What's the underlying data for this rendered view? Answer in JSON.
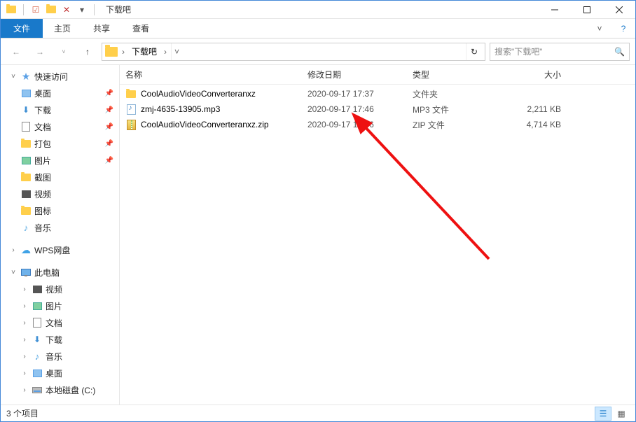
{
  "window": {
    "title": "下载吧"
  },
  "ribbon": {
    "file": "文件",
    "tabs": [
      "主页",
      "共享",
      "查看"
    ]
  },
  "address": {
    "segments": [
      "下载吧"
    ],
    "search_placeholder": "搜索\"下载吧\""
  },
  "sidebar": {
    "quick_access": "快速访问",
    "quick_items": [
      {
        "label": "桌面",
        "pin": true,
        "icon": "desktop"
      },
      {
        "label": "下载",
        "pin": true,
        "icon": "down"
      },
      {
        "label": "文档",
        "pin": true,
        "icon": "doc"
      },
      {
        "label": "打包",
        "pin": true,
        "icon": "folder"
      },
      {
        "label": "图片",
        "pin": true,
        "icon": "pic"
      },
      {
        "label": "截图",
        "pin": false,
        "icon": "folder"
      },
      {
        "label": "视频",
        "pin": false,
        "icon": "video"
      },
      {
        "label": "图标",
        "pin": false,
        "icon": "folder"
      },
      {
        "label": "音乐",
        "pin": false,
        "icon": "music"
      }
    ],
    "wps": "WPS网盘",
    "this_pc": "此电脑",
    "pc_items": [
      {
        "label": "视频",
        "icon": "video"
      },
      {
        "label": "图片",
        "icon": "pic"
      },
      {
        "label": "文档",
        "icon": "doc"
      },
      {
        "label": "下载",
        "icon": "down"
      },
      {
        "label": "音乐",
        "icon": "music"
      },
      {
        "label": "桌面",
        "icon": "desktop"
      },
      {
        "label": "本地磁盘 (C:)",
        "icon": "disk"
      }
    ]
  },
  "columns": {
    "name": "名称",
    "date": "修改日期",
    "type": "类型",
    "size": "大小"
  },
  "files": [
    {
      "name": "CoolAudioVideoConverteranxz",
      "date": "2020-09-17 17:37",
      "type": "文件夹",
      "size": "",
      "icon": "folder"
    },
    {
      "name": "zmj-4635-13905.mp3",
      "date": "2020-09-17 17:46",
      "type": "MP3 文件",
      "size": "2,211 KB",
      "icon": "mp3"
    },
    {
      "name": "CoolAudioVideoConverteranxz.zip",
      "date": "2020-09-17 17:36",
      "type": "ZIP 文件",
      "size": "4,714 KB",
      "icon": "zip"
    }
  ],
  "status": {
    "count_label": "3 个项目"
  }
}
